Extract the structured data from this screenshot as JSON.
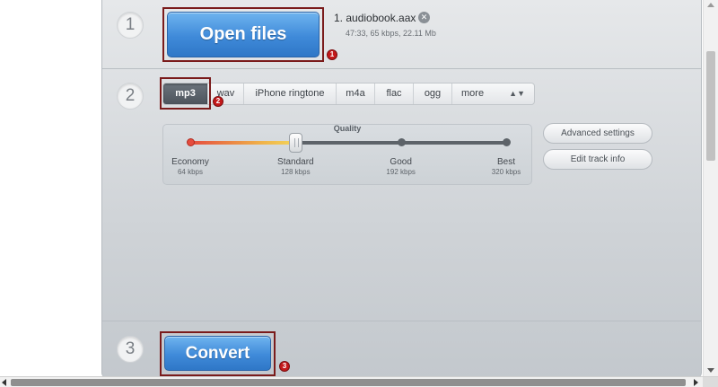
{
  "steps": [
    "1",
    "2",
    "3"
  ],
  "open_files": {
    "label": "Open files",
    "badge": "1"
  },
  "file": {
    "name": "1. audiobook.aax",
    "meta": "47:33, 65 kbps, 22.11 Mb",
    "remove_icon": "close-circle-icon"
  },
  "formats": {
    "tabs": [
      "mp3",
      "wav",
      "iPhone ringtone",
      "m4a",
      "flac",
      "ogg",
      "more"
    ],
    "selected": "mp3",
    "badge": "2"
  },
  "quality": {
    "title": "Quality",
    "selected_index": 1,
    "levels": [
      {
        "label": "Economy",
        "bitrate": "64 kbps"
      },
      {
        "label": "Standard",
        "bitrate": "128 kbps"
      },
      {
        "label": "Good",
        "bitrate": "192 kbps"
      },
      {
        "label": "Best",
        "bitrate": "320 kbps"
      }
    ]
  },
  "buttons": {
    "advanced": "Advanced settings",
    "track_info": "Edit track info"
  },
  "convert": {
    "label": "Convert",
    "badge": "3"
  },
  "colors": {
    "button_blue": "#3f8ad9",
    "highlight": "#7a1b1b",
    "badge_red": "#c4191b"
  }
}
